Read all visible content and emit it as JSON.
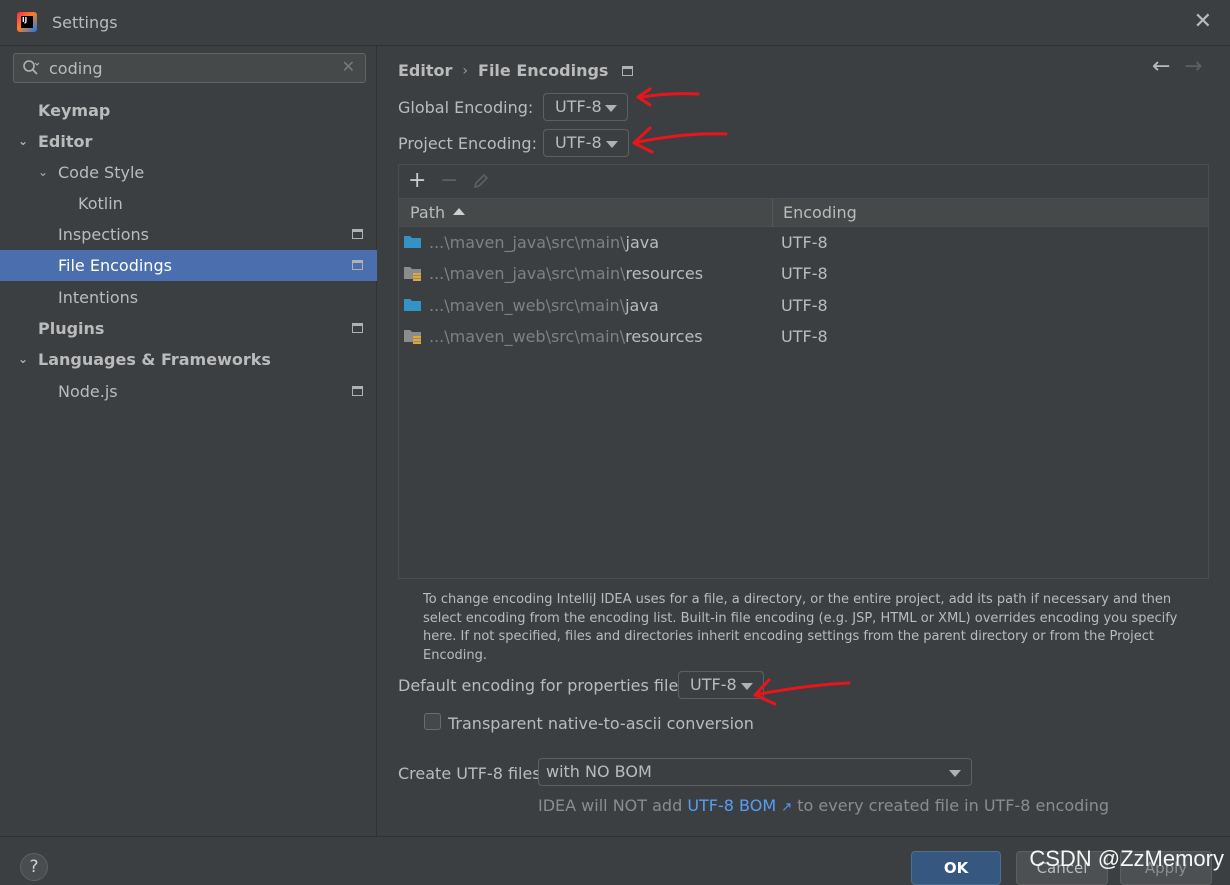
{
  "window": {
    "title": "Settings"
  },
  "search": {
    "value": "coding"
  },
  "sidebar": {
    "items": [
      {
        "label": "Keymap"
      },
      {
        "label": "Editor"
      },
      {
        "label": "Code Style"
      },
      {
        "label": "Kotlin"
      },
      {
        "label": "Inspections"
      },
      {
        "label": "File Encodings"
      },
      {
        "label": "Intentions"
      },
      {
        "label": "Plugins"
      },
      {
        "label": "Languages & Frameworks"
      },
      {
        "label": "Node.js"
      }
    ]
  },
  "breadcrumb": {
    "parent": "Editor",
    "current": "File Encodings"
  },
  "global_encoding": {
    "label": "Global Encoding:",
    "value": "UTF-8"
  },
  "project_encoding": {
    "label": "Project Encoding:",
    "value": "UTF-8"
  },
  "table": {
    "columns": {
      "path": "Path",
      "encoding": "Encoding"
    },
    "rows": [
      {
        "prefix": "...\\maven_java\\src\\main\\",
        "name": "java",
        "encoding": "UTF-8",
        "icon": "source-folder-icon"
      },
      {
        "prefix": "...\\maven_java\\src\\main\\",
        "name": "resources",
        "encoding": "UTF-8",
        "icon": "resources-folder-icon"
      },
      {
        "prefix": "...\\maven_web\\src\\main\\",
        "name": "java",
        "encoding": "UTF-8",
        "icon": "source-folder-icon"
      },
      {
        "prefix": "...\\maven_web\\src\\main\\",
        "name": "resources",
        "encoding": "UTF-8",
        "icon": "resources-folder-icon"
      }
    ]
  },
  "help_text": "To change encoding IntelliJ IDEA uses for a file, a directory, or the entire project, add its path if necessary and then select encoding from the encoding list. Built-in file encoding (e.g. JSP, HTML or XML) overrides encoding you specify here. If not specified, files and directories inherit encoding settings from the parent directory or from the Project Encoding.",
  "properties_encoding": {
    "label": "Default encoding for properties files:",
    "value": "UTF-8"
  },
  "native_to_ascii": {
    "label": "Transparent native-to-ascii conversion",
    "checked": false
  },
  "utf8_files": {
    "label": "Create UTF-8 files:",
    "value": "with NO BOM"
  },
  "bom_info": {
    "before": "IDEA will NOT add ",
    "link": "UTF-8 BOM",
    "link_arrow": "↗",
    "after": " to every created file in UTF-8 encoding"
  },
  "footer": {
    "help": "?",
    "ok": "OK",
    "cancel": "Cancel",
    "apply": "Apply"
  },
  "watermark": "CSDN @ZzMemory",
  "colors": {
    "selection": "#4b6eaf",
    "link": "#589df6",
    "annotation": "#e8151b"
  }
}
